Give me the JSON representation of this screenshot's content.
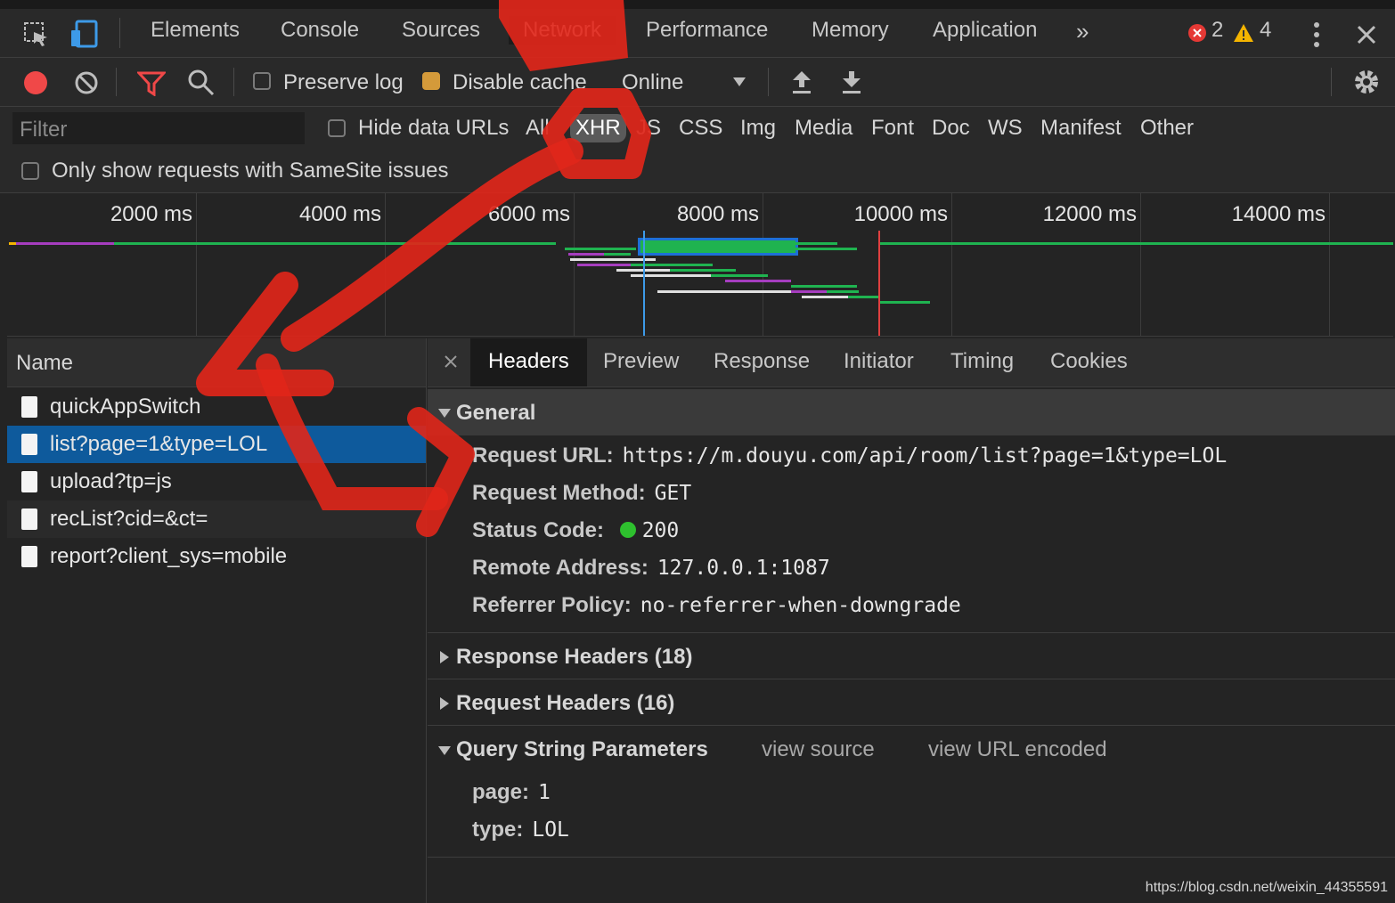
{
  "main_tabs": [
    "Elements",
    "Console",
    "Sources",
    "Network",
    "Performance",
    "Memory",
    "Application"
  ],
  "errors_count": "2",
  "warnings_count": "4",
  "toolbar": {
    "preserve_log": "Preserve log",
    "disable_cache": "Disable cache",
    "throttle": "Online"
  },
  "filter": {
    "placeholder": "Filter",
    "hide_data_urls": "Hide data URLs",
    "types": [
      "All",
      "XHR",
      "JS",
      "CSS",
      "Img",
      "Media",
      "Font",
      "Doc",
      "WS",
      "Manifest",
      "Other"
    ],
    "samesite": "Only show requests with SameSite issues"
  },
  "timeline_ticks": [
    "2000 ms",
    "4000 ms",
    "6000 ms",
    "8000 ms",
    "10000 ms",
    "12000 ms",
    "14000 ms"
  ],
  "name_header": "Name",
  "requests": [
    "quickAppSwitch",
    "list?page=1&type=LOL",
    "upload?tp=js",
    "recList?cid=&ct=",
    "report?client_sys=mobile"
  ],
  "detail_tabs": [
    "Headers",
    "Preview",
    "Response",
    "Initiator",
    "Timing",
    "Cookies"
  ],
  "general": {
    "title": "General",
    "request_url_label": "Request URL:",
    "request_url": "https://m.douyu.com/api/room/list?page=1&type=LOL",
    "method_label": "Request Method:",
    "method": "GET",
    "status_label": "Status Code:",
    "status": "200",
    "remote_label": "Remote Address:",
    "remote": "127.0.0.1:1087",
    "referrer_label": "Referrer Policy:",
    "referrer": "no-referrer-when-downgrade"
  },
  "response_headers": "Response Headers (18)",
  "request_headers": "Request Headers (16)",
  "query": {
    "title": "Query String Parameters",
    "view_source": "view source",
    "view_url_encoded": "view URL encoded",
    "page_label": "page:",
    "page": "1",
    "type_label": "type:",
    "type": "LOL"
  },
  "watermark": "https://blog.csdn.net/weixin_44355591",
  "colors": {
    "selected_row": "#0e5a9c",
    "record": "#f04848",
    "status_ok": "#2ec02e",
    "annotation": "#e0261a"
  }
}
